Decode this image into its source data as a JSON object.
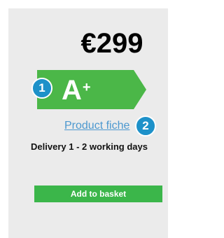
{
  "product": {
    "price": "€299",
    "energy_class": "A",
    "energy_class_suffix": "+",
    "energy_label_color": "#4bb748",
    "product_fiche_label": "Product fiche",
    "delivery_text": "Delivery 1 - 2 working days",
    "add_to_basket_label": "Add to basket",
    "add_to_basket_color": "#3bb64a"
  },
  "annotations": {
    "badge_1": "1",
    "badge_2": "2",
    "badge_color": "#1d91c9"
  }
}
